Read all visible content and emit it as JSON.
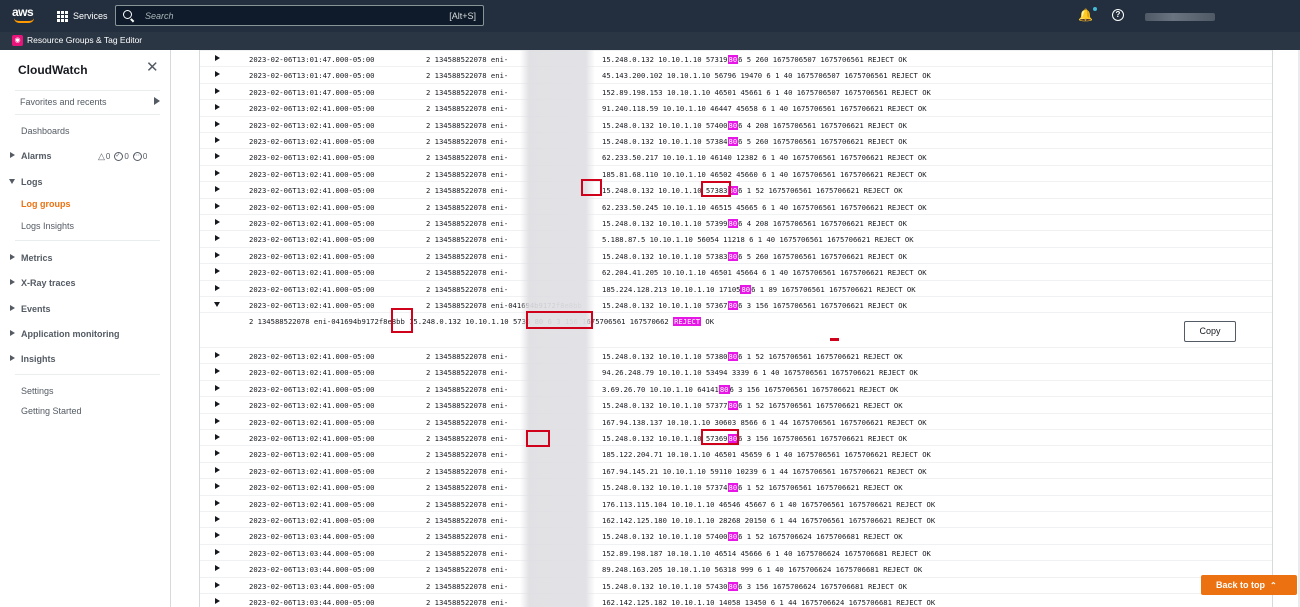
{
  "topnav": {
    "logo": "aws",
    "services_label": "Services",
    "search_placeholder": "Search",
    "search_shortcut": "[Alt+S]"
  },
  "subnav": {
    "resource_groups_label": "Resource Groups & Tag Editor"
  },
  "sidebar": {
    "title": "CloudWatch",
    "favorites": "Favorites and recents",
    "dashboards": "Dashboards",
    "alarms": "Alarms",
    "alarm_counts": {
      "alarm": "0",
      "ok": "0",
      "insufficient": "0"
    },
    "logs": "Logs",
    "log_groups": "Log groups",
    "logs_insights": "Logs Insights",
    "metrics": "Metrics",
    "xray": "X-Ray traces",
    "events": "Events",
    "app_monitoring": "Application monitoring",
    "insights": "Insights",
    "settings": "Settings",
    "getting_started": "Getting Started"
  },
  "log": {
    "acct_prefix": "2 134588522078 eni-",
    "rows_top": [
      {
        "ts": "2023-02-06T13:01:47.000-05:00",
        "pre": "15.248.0.132 10.10.1.10 57319",
        "hl": "80",
        "post": "6 5 260 1675706507 1675706561 REJECT OK"
      },
      {
        "ts": "2023-02-06T13:01:47.000-05:00",
        "pre": "45.143.200.102 10.10.1.10 56796 19470 6 1 40 1675706507 1675706561 REJECT OK",
        "hl": "",
        "post": ""
      },
      {
        "ts": "2023-02-06T13:01:47.000-05:00",
        "pre": "152.89.198.153 10.10.1.10 46501 45661 6 1 40 1675706507 1675706561 REJECT OK",
        "hl": "",
        "post": ""
      },
      {
        "ts": "2023-02-06T13:02:41.000-05:00",
        "pre": "91.240.118.59 10.10.1.10 46447 45658 6 1 40 1675706561 1675706621 REJECT OK",
        "hl": "",
        "post": ""
      },
      {
        "ts": "2023-02-06T13:02:41.000-05:00",
        "pre": "15.248.0.132 10.10.1.10 57400",
        "hl": "80",
        "post": "6 4 208 1675706561 1675706621 REJECT OK"
      },
      {
        "ts": "2023-02-06T13:02:41.000-05:00",
        "pre": "15.248.0.132 10.10.1.10 57384",
        "hl": "80",
        "post": "6 5 260 1675706561 1675706621 REJECT OK"
      },
      {
        "ts": "2023-02-06T13:02:41.000-05:00",
        "pre": "62.233.50.217 10.10.1.10 46140 12382 6 1 40 1675706561 1675706621 REJECT OK",
        "hl": "",
        "post": ""
      },
      {
        "ts": "2023-02-06T13:02:41.000-05:00",
        "pre": "185.81.68.110 10.10.1.10 46502 45660 6 1 40 1675706561 1675706621 REJECT OK",
        "hl": "",
        "post": ""
      },
      {
        "ts": "2023-02-06T13:02:41.000-05:00",
        "pre": "15.248.0.132 10.10.1.10 57383",
        "hl": "80",
        "post": "6 1 52 1675706561 1675706621 REJECT OK"
      },
      {
        "ts": "2023-02-06T13:02:41.000-05:00",
        "pre": "62.233.50.245 10.10.1.10 46515 45665 6 1 40 1675706561 1675706621 REJECT OK",
        "hl": "",
        "post": ""
      },
      {
        "ts": "2023-02-06T13:02:41.000-05:00",
        "pre": "15.248.0.132 10.10.1.10 57399",
        "hl": "80",
        "post": "6 4 208 1675706561 1675706621 REJECT OK"
      },
      {
        "ts": "2023-02-06T13:02:41.000-05:00",
        "pre": "5.188.87.5 10.10.1.10 56054 11218 6 1 40 1675706561 1675706621 REJECT OK",
        "hl": "",
        "post": ""
      },
      {
        "ts": "2023-02-06T13:02:41.000-05:00",
        "pre": "15.248.0.132 10.10.1.10 57383",
        "hl": "80",
        "post": "6 5 260 1675706561 1675706621 REJECT OK"
      },
      {
        "ts": "2023-02-06T13:02:41.000-05:00",
        "pre": "62.204.41.205 10.10.1.10 46501 45664 6 1 40 1675706561 1675706621 REJECT OK",
        "hl": "",
        "post": ""
      },
      {
        "ts": "2023-02-06T13:02:41.000-05:00",
        "pre": "185.224.128.213 10.10.1.10 17105",
        "hl": "80",
        "post": "6 1 89 1675706561 1675706621 REJECT OK"
      }
    ],
    "expanded_row": {
      "ts": "2023-02-06T13:02:41.000-05:00",
      "acct": "2 134588522078 eni-041694b9172f8e8bb",
      "pre": "15.248.0.132 10.10.1.10 57367",
      "hl": "80",
      "post": "6 3 156 1675706561 1675706621 REJECT OK",
      "full_pre": "2 134588522078 eni-041694b9172f8e8bb 15.248.0.132 10.10.1.10 5736",
      "full_hl": "80",
      "full_mid": "6 3 156 1675706561 167570662",
      "full_reject": "REJECT",
      "full_post": "OK",
      "copy_label": "Copy"
    },
    "rows_bottom": [
      {
        "ts": "2023-02-06T13:02:41.000-05:00",
        "pre": "15.248.0.132 10.10.1.10 57380",
        "hl": "80",
        "post": "6 1 52 1675706561 1675706621 REJECT OK"
      },
      {
        "ts": "2023-02-06T13:02:41.000-05:00",
        "pre": "94.26.248.79 10.10.1.10 53494 3339 6 1 40 1675706561 1675706621 REJECT OK",
        "hl": "",
        "post": ""
      },
      {
        "ts": "2023-02-06T13:02:41.000-05:00",
        "pre": "3.69.26.70 10.10.1.10 64141",
        "hl": "80",
        "post": "6 3 156 1675706561 1675706621 REJECT OK"
      },
      {
        "ts": "2023-02-06T13:02:41.000-05:00",
        "pre": "15.248.0.132 10.10.1.10 57377",
        "hl": "80",
        "post": "6 1 52 1675706561 1675706621 REJECT OK"
      },
      {
        "ts": "2023-02-06T13:02:41.000-05:00",
        "pre": "167.94.138.137 10.10.1.10 30603 8566 6 1 44 1675706561 1675706621 REJECT OK",
        "hl": "",
        "post": ""
      },
      {
        "ts": "2023-02-06T13:02:41.000-05:00",
        "pre": "15.248.0.132 10.10.1.10 57369",
        "hl": "80",
        "post": "6 3 156 1675706561 1675706621 REJECT OK"
      },
      {
        "ts": "2023-02-06T13:02:41.000-05:00",
        "pre": "185.122.204.71 10.10.1.10 46501 45659 6 1 40 1675706561 1675706621 REJECT OK",
        "hl": "",
        "post": ""
      },
      {
        "ts": "2023-02-06T13:02:41.000-05:00",
        "pre": "167.94.145.21 10.10.1.10 59110 10239 6 1 44 1675706561 1675706621 REJECT OK",
        "hl": "",
        "post": ""
      },
      {
        "ts": "2023-02-06T13:02:41.000-05:00",
        "pre": "15.248.0.132 10.10.1.10 57374",
        "hl": "80",
        "post": "6 1 52 1675706561 1675706621 REJECT OK"
      },
      {
        "ts": "2023-02-06T13:02:41.000-05:00",
        "pre": "176.113.115.104 10.10.1.10 46546 45667 6 1 40 1675706561 1675706621 REJECT OK",
        "hl": "",
        "post": ""
      },
      {
        "ts": "2023-02-06T13:02:41.000-05:00",
        "pre": "162.142.125.180 10.10.1.10 28268 20150 6 1 44 1675706561 1675706621 REJECT OK",
        "hl": "",
        "post": ""
      },
      {
        "ts": "2023-02-06T13:03:44.000-05:00",
        "pre": "15.248.0.132 10.10.1.10 57400",
        "hl": "80",
        "post": "6 1 52 1675706624 1675706681 REJECT OK"
      },
      {
        "ts": "2023-02-06T13:03:44.000-05:00",
        "pre": "152.89.198.187 10.10.1.10 46514 45666 6 1 40 1675706624 1675706681 REJECT OK",
        "hl": "",
        "post": ""
      },
      {
        "ts": "2023-02-06T13:03:44.000-05:00",
        "pre": "89.248.163.205 10.10.1.10 56318 999 6 1 40 1675706624 1675706681 REJECT OK",
        "hl": "",
        "post": ""
      },
      {
        "ts": "2023-02-06T13:03:44.000-05:00",
        "pre": "15.248.0.132 10.10.1.10 57430",
        "hl": "80",
        "post": "6 3 156 1675706624 1675706681 REJECT OK"
      },
      {
        "ts": "2023-02-06T13:03:44.000-05:00",
        "pre": "162.142.125.182 10.10.1.10 14058 13450 6 1 44 1675706624 1675706681 REJECT OK",
        "hl": "",
        "post": ""
      }
    ]
  },
  "back_to_top": "Back to top",
  "colors": {
    "highlight": "#e617e6",
    "annotation_red": "#d0021b",
    "accent_orange": "#ec7211",
    "nav_bg": "#232f3e"
  }
}
